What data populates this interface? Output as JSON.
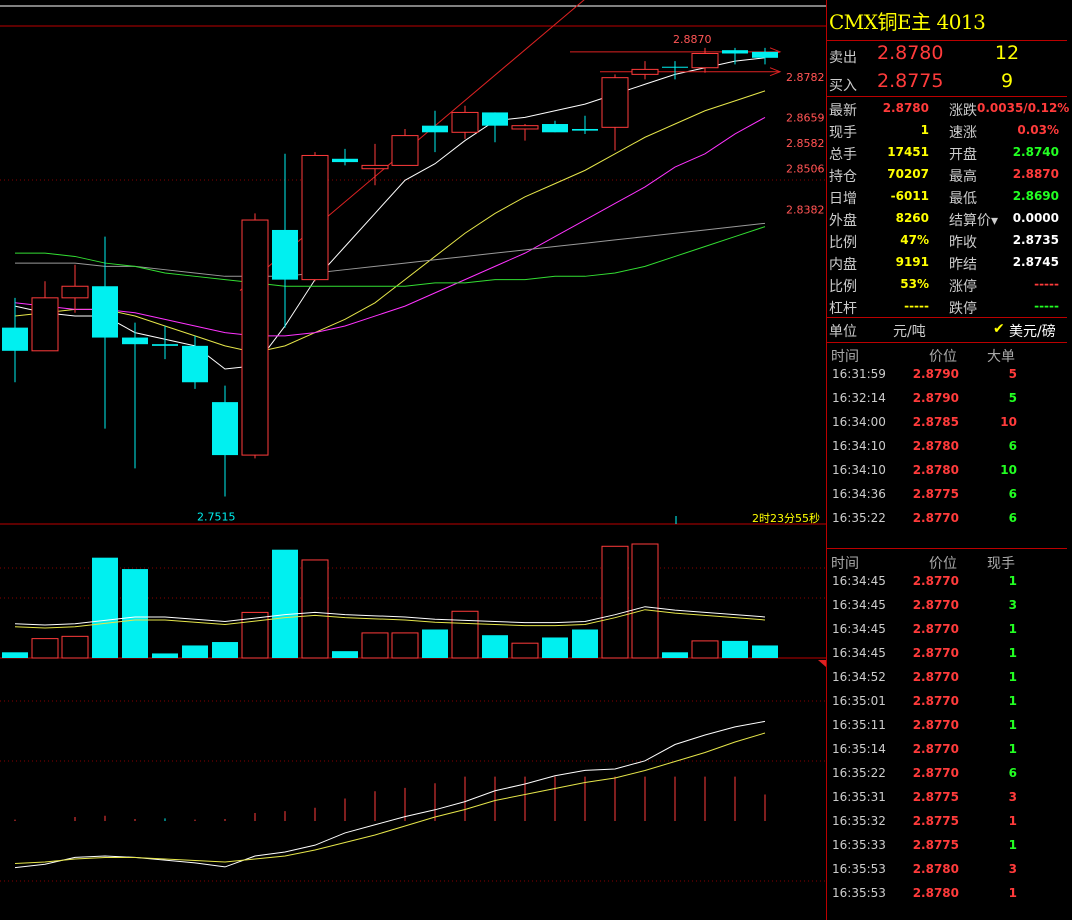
{
  "header": {
    "title": "CMX铜E主  4013"
  },
  "book": [
    {
      "label": "卖出",
      "price": "2.8780",
      "qty": "12"
    },
    {
      "label": "买入",
      "price": "2.8775",
      "qty": "9"
    }
  ],
  "quote": [
    {
      "l1": "最新",
      "v1": "2.8780",
      "c1": "red",
      "l2": "涨跌",
      "v2": "0.0035/0.12%",
      "c2": "red"
    },
    {
      "l1": "现手",
      "v1": "1",
      "c1": "yel",
      "l2": "速涨",
      "v2": "0.03%",
      "c2": "red"
    },
    {
      "l1": "总手",
      "v1": "17451",
      "c1": "yel",
      "l2": "开盘",
      "v2": "2.8740",
      "c2": "grn"
    },
    {
      "l1": "持仓",
      "v1": "70207",
      "c1": "yel",
      "l2": "最高",
      "v2": "2.8870",
      "c2": "red"
    },
    {
      "l1": "日增",
      "v1": "-6011",
      "c1": "yel",
      "l2": "最低",
      "v2": "2.8690",
      "c2": "grn"
    },
    {
      "l1": "外盘",
      "v1": "8260",
      "c1": "yel",
      "l2": "结算价▾",
      "v2": "0.0000",
      "c2": "wht"
    },
    {
      "l1": "比例",
      "v1": "47%",
      "c1": "yel",
      "l2": "昨收",
      "v2": "2.8735",
      "c2": "wht"
    },
    {
      "l1": "内盘",
      "v1": "9191",
      "c1": "yel",
      "l2": "昨结",
      "v2": "2.8745",
      "c2": "wht"
    },
    {
      "l1": "比例",
      "v1": "53%",
      "c1": "yel",
      "l2": "涨停",
      "v2": "-----",
      "c2": "red"
    },
    {
      "l1": "杠杆",
      "v1": "-----",
      "c1": "yel",
      "l2": "跌停",
      "v2": "-----",
      "c2": "grn"
    }
  ],
  "units": {
    "label": "单位",
    "value": "元/吨",
    "alt": "美元/磅"
  },
  "big_trades": {
    "headers": [
      "时间",
      "价位",
      "大单"
    ],
    "rows": [
      {
        "time": "16:31:59",
        "price": "2.8790",
        "qty": "5",
        "c": "red"
      },
      {
        "time": "16:32:14",
        "price": "2.8790",
        "qty": "5",
        "c": "grn"
      },
      {
        "time": "16:34:00",
        "price": "2.8785",
        "qty": "10",
        "c": "red"
      },
      {
        "time": "16:34:10",
        "price": "2.8780",
        "qty": "6",
        "c": "grn"
      },
      {
        "time": "16:34:10",
        "price": "2.8780",
        "qty": "10",
        "c": "grn"
      },
      {
        "time": "16:34:36",
        "price": "2.8775",
        "qty": "6",
        "c": "grn"
      },
      {
        "time": "16:35:22",
        "price": "2.8770",
        "qty": "6",
        "c": "grn"
      }
    ]
  },
  "ticks": {
    "headers": [
      "时间",
      "价位",
      "现手"
    ],
    "rows": [
      {
        "time": "16:34:45",
        "price": "2.8770",
        "qty": "1",
        "c": "grn"
      },
      {
        "time": "16:34:45",
        "price": "2.8770",
        "qty": "3",
        "c": "grn"
      },
      {
        "time": "16:34:45",
        "price": "2.8770",
        "qty": "1",
        "c": "grn"
      },
      {
        "time": "16:34:45",
        "price": "2.8770",
        "qty": "1",
        "c": "grn"
      },
      {
        "time": "16:34:52",
        "price": "2.8770",
        "qty": "1",
        "c": "grn"
      },
      {
        "time": "16:35:01",
        "price": "2.8770",
        "qty": "1",
        "c": "grn"
      },
      {
        "time": "16:35:11",
        "price": "2.8770",
        "qty": "1",
        "c": "grn"
      },
      {
        "time": "16:35:14",
        "price": "2.8770",
        "qty": "1",
        "c": "grn"
      },
      {
        "time": "16:35:22",
        "price": "2.8770",
        "qty": "6",
        "c": "grn"
      },
      {
        "time": "16:35:31",
        "price": "2.8775",
        "qty": "3",
        "c": "red"
      },
      {
        "time": "16:35:32",
        "price": "2.8775",
        "qty": "1",
        "c": "red"
      },
      {
        "time": "16:35:33",
        "price": "2.8775",
        "qty": "1",
        "c": "grn"
      },
      {
        "time": "16:35:53",
        "price": "2.8780",
        "qty": "3",
        "c": "red"
      },
      {
        "time": "16:35:53",
        "price": "2.8780",
        "qty": "1",
        "c": "red"
      }
    ]
  },
  "chart_data": {
    "type": "candlestick",
    "ylim": [
      2.745,
      2.893
    ],
    "high_label": "2.8870",
    "low_label": "2.7515",
    "countdown": "2时23分55秒",
    "price_levels": [
      "2.8782",
      "2.8659",
      "2.8582",
      "2.8506",
      "2.8382"
    ],
    "candles": [
      {
        "o": 2.8025,
        "h": 2.8115,
        "l": 2.786,
        "c": 2.7955
      },
      {
        "o": 2.7955,
        "h": 2.8165,
        "l": 2.7955,
        "c": 2.8115
      },
      {
        "o": 2.8115,
        "h": 2.8215,
        "l": 2.807,
        "c": 2.815
      },
      {
        "o": 2.815,
        "h": 2.83,
        "l": 2.772,
        "c": 2.7995
      },
      {
        "o": 2.7995,
        "h": 2.804,
        "l": 2.76,
        "c": 2.7975
      },
      {
        "o": 2.7975,
        "h": 2.803,
        "l": 2.793,
        "c": 2.797
      },
      {
        "o": 2.797,
        "h": 2.8,
        "l": 2.784,
        "c": 2.786
      },
      {
        "o": 2.78,
        "h": 2.785,
        "l": 2.7515,
        "c": 2.764
      },
      {
        "o": 2.764,
        "h": 2.837,
        "l": 2.763,
        "c": 2.835
      },
      {
        "o": 2.832,
        "h": 2.855,
        "l": 2.8025,
        "c": 2.817
      },
      {
        "o": 2.817,
        "h": 2.8555,
        "l": 2.8165,
        "c": 2.8545
      },
      {
        "o": 2.8535,
        "h": 2.8565,
        "l": 2.8515,
        "c": 2.8525
      },
      {
        "o": 2.8505,
        "h": 2.858,
        "l": 2.8455,
        "c": 2.8515
      },
      {
        "o": 2.8515,
        "h": 2.8625,
        "l": 2.8515,
        "c": 2.8605
      },
      {
        "o": 2.8635,
        "h": 2.868,
        "l": 2.8555,
        "c": 2.8615
      },
      {
        "o": 2.8615,
        "h": 2.8695,
        "l": 2.8595,
        "c": 2.8675
      },
      {
        "o": 2.8675,
        "h": 2.8675,
        "l": 2.8585,
        "c": 2.8635
      },
      {
        "o": 2.8625,
        "h": 2.864,
        "l": 2.859,
        "c": 2.8635
      },
      {
        "o": 2.864,
        "h": 2.865,
        "l": 2.8615,
        "c": 2.8615
      },
      {
        "o": 2.8625,
        "h": 2.8665,
        "l": 2.861,
        "c": 2.862
      },
      {
        "o": 2.863,
        "h": 2.879,
        "l": 2.856,
        "c": 2.878
      },
      {
        "o": 2.879,
        "h": 2.883,
        "l": 2.8775,
        "c": 2.8805
      },
      {
        "o": 2.8813,
        "h": 2.883,
        "l": 2.8775,
        "c": 2.881
      },
      {
        "o": 2.881,
        "h": 2.887,
        "l": 2.8795,
        "c": 2.8853
      },
      {
        "o": 2.8863,
        "h": 2.887,
        "l": 2.882,
        "c": 2.8853
      },
      {
        "o": 2.8858,
        "h": 2.887,
        "l": 2.882,
        "c": 2.884
      }
    ],
    "ma": [
      {
        "name": "white",
        "color": "#ffffff",
        "values": [
          2.809,
          2.807,
          2.806,
          2.806,
          2.801,
          2.799,
          2.797,
          2.79,
          2.791,
          2.803,
          2.817,
          2.827,
          2.837,
          2.847,
          2.852,
          2.859,
          2.865,
          2.866,
          2.868,
          2.87,
          2.873,
          2.876,
          2.879,
          2.881,
          2.883,
          2.884
        ]
      },
      {
        "name": "yellow",
        "color": "#e6e64a",
        "values": [
          2.806,
          2.807,
          2.808,
          2.808,
          2.806,
          2.803,
          2.8,
          2.797,
          2.795,
          2.797,
          2.801,
          2.805,
          2.81,
          2.817,
          2.824,
          2.831,
          2.837,
          2.842,
          2.846,
          2.85,
          2.855,
          2.86,
          2.864,
          2.868,
          2.871,
          2.874
        ]
      },
      {
        "name": "magenta",
        "color": "#ff33ff",
        "values": [
          2.81,
          2.809,
          2.808,
          2.808,
          2.807,
          2.805,
          2.803,
          2.801,
          2.8,
          2.8,
          2.801,
          2.803,
          2.806,
          2.809,
          2.813,
          2.817,
          2.821,
          2.825,
          2.83,
          2.835,
          2.84,
          2.845,
          2.851,
          2.855,
          2.861,
          2.866
        ]
      },
      {
        "name": "gray",
        "color": "#999999",
        "values": [
          2.822,
          2.822,
          2.822,
          2.821,
          2.821,
          2.82,
          2.819,
          2.818,
          2.818,
          2.818,
          2.819,
          2.82,
          2.821,
          2.822,
          2.823,
          2.824,
          2.825,
          2.826,
          2.827,
          2.828,
          2.829,
          2.83,
          2.831,
          2.832,
          2.833,
          2.834
        ]
      },
      {
        "name": "green",
        "color": "#33dd33",
        "values": [
          2.825,
          2.825,
          2.824,
          2.822,
          2.821,
          2.819,
          2.818,
          2.817,
          2.816,
          2.815,
          2.815,
          2.815,
          2.815,
          2.815,
          2.816,
          2.816,
          2.817,
          2.817,
          2.818,
          2.818,
          2.819,
          2.821,
          2.824,
          2.827,
          2.83,
          2.833
        ]
      }
    ],
    "volume": [
      0.05,
      0.17,
      0.19,
      0.88,
      0.78,
      0.04,
      0.11,
      0.14,
      0.4,
      0.95,
      0.86,
      0.06,
      0.22,
      0.22,
      0.25,
      0.41,
      0.2,
      0.13,
      0.18,
      0.25,
      0.98,
      1.0,
      0.05,
      0.15,
      0.15,
      0.11
    ],
    "volume_avg": [
      0.3,
      0.29,
      0.3,
      0.33,
      0.36,
      0.36,
      0.34,
      0.32,
      0.35,
      0.38,
      0.4,
      0.38,
      0.37,
      0.36,
      0.34,
      0.33,
      0.32,
      0.31,
      0.31,
      0.32,
      0.38,
      0.45,
      0.42,
      0.4,
      0.38,
      0.36
    ],
    "indicator_bars": [
      0.02,
      0.0,
      0.06,
      0.08,
      0.03,
      0.04,
      0.02,
      0.03,
      0.12,
      0.15,
      0.2,
      0.34,
      0.45,
      0.5,
      0.57,
      0.67,
      0.67,
      0.67,
      0.67,
      0.67,
      0.67,
      0.67,
      0.67,
      0.67,
      0.67,
      0.4
    ],
    "indicator_line1": [
      0.05,
      0.1,
      0.2,
      0.22,
      0.2,
      0.16,
      0.12,
      0.06,
      0.22,
      0.28,
      0.38,
      0.56,
      0.68,
      0.8,
      0.9,
      1.02,
      1.18,
      1.28,
      1.4,
      1.48,
      1.5,
      1.62,
      1.86,
      2.0,
      2.12,
      2.2
    ],
    "indicator_line2": [
      0.1,
      0.12,
      0.16,
      0.18,
      0.18,
      0.16,
      0.14,
      0.12,
      0.16,
      0.2,
      0.28,
      0.38,
      0.48,
      0.6,
      0.72,
      0.82,
      0.94,
      1.02,
      1.1,
      1.18,
      1.24,
      1.34,
      1.46,
      1.58,
      1.72,
      1.84
    ]
  }
}
